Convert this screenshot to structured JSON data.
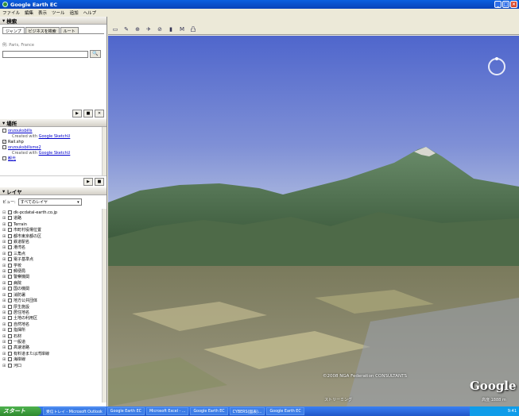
{
  "window": {
    "title": "Google Earth EC"
  },
  "menu": [
    "ファイル",
    "編集",
    "表示",
    "ツール",
    "追加",
    "ヘルプ"
  ],
  "search": {
    "header": "検索",
    "tabs": [
      "ジャンプ",
      "ビジネスを検索",
      "ルート"
    ],
    "hint": "例: Paris, France",
    "value": "",
    "search_button": "🔍"
  },
  "search_controls": [
    "▶",
    "■",
    "✕"
  ],
  "places": {
    "header": "場所",
    "items": [
      {
        "title": "onzouksbills",
        "note": "Created with",
        "link": "Google SketchU"
      },
      {
        "title": "Rail.shp",
        "note": "",
        "link": ""
      },
      {
        "title": "onzouksbillsme2",
        "note": "Created with",
        "link": "Google SketchU"
      },
      {
        "title": "観光",
        "note": "",
        "link": ""
      }
    ],
    "controls": [
      "▶",
      "■"
    ]
  },
  "layers": {
    "header": "レイヤ",
    "view_label": "ビュー:",
    "view_value": "すべてのレイヤ",
    "items": [
      "dk-pcdatal-earth.co.jp",
      "道路",
      "Terrain",
      "市町村役場位置",
      "都市東京都の区",
      "鉄道駅名",
      "港湾名",
      "三角点",
      "電子基準点",
      "学校",
      "郵便局",
      "警察機関",
      "病院",
      "国の機関",
      "消防署",
      "地方公共団体",
      "厚生施設",
      "居住地名",
      "土地の利用区",
      "自然地名",
      "指揮所",
      "石材",
      "一般道",
      "高速道路",
      "有料道または湾岸線",
      "海岸線",
      "河口"
    ]
  },
  "toolbar": [
    "▭",
    "✎",
    "⊕",
    "✈",
    "⊘",
    "▮",
    "M",
    "凸"
  ],
  "map": {
    "credits": "©2008 NGA Federation CONSULTANTS",
    "status_left": "ストリーミング",
    "status_right": "高度 1888 m",
    "logo": "Google"
  },
  "taskbar": {
    "start": "スタート",
    "tasks": [
      "受信トレイ - Microsoft Outlook",
      "Google Earth EC",
      "Microsoft Excel - ...",
      "Google Earth EC",
      "CYBERS(図表)...",
      "Google Earth EC"
    ],
    "clock": "9:41"
  },
  "colors": {
    "titlebar": "#0a5fe0",
    "sky_top": "#4f66cc",
    "sky_bottom": "#b3bfe0",
    "taskbar": "#245edb"
  }
}
